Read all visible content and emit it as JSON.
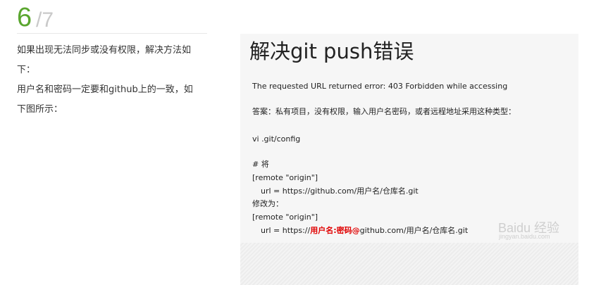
{
  "step": {
    "current": "6",
    "total": "/7"
  },
  "description": {
    "line1": "如果出现无法同步或没有权限，解决方法如",
    "line2": "下：",
    "line3": "用户名和密码一定要和github上的一致，如",
    "line4": "下图所示："
  },
  "screenshot": {
    "title": "解决git push错误",
    "error_line": "The requested URL returned error: 403 Forbidden while accessing",
    "answer_line": "答案：私有项目，没有权限，输入用户名密码，或者远程地址采用这种类型：",
    "config_cmd": "vi .git/config",
    "comment": "# 将",
    "remote1": "[remote \"origin\"]",
    "url1": "url = https://github.com/用户名/仓库名.git",
    "change_to": "修改为：",
    "remote2": "[remote \"origin\"]",
    "url2_prefix": "url = https://",
    "url2_credentials": "用户名:密码@",
    "url2_suffix": "github.com/用户名/仓库名.git",
    "watermark": "Baidu 经验",
    "watermark_sub": "jingyan.baidu.com"
  },
  "colors": {
    "step_number": "#5aa62f",
    "step_total": "#c9c9c9",
    "highlight_red": "#e00000"
  }
}
